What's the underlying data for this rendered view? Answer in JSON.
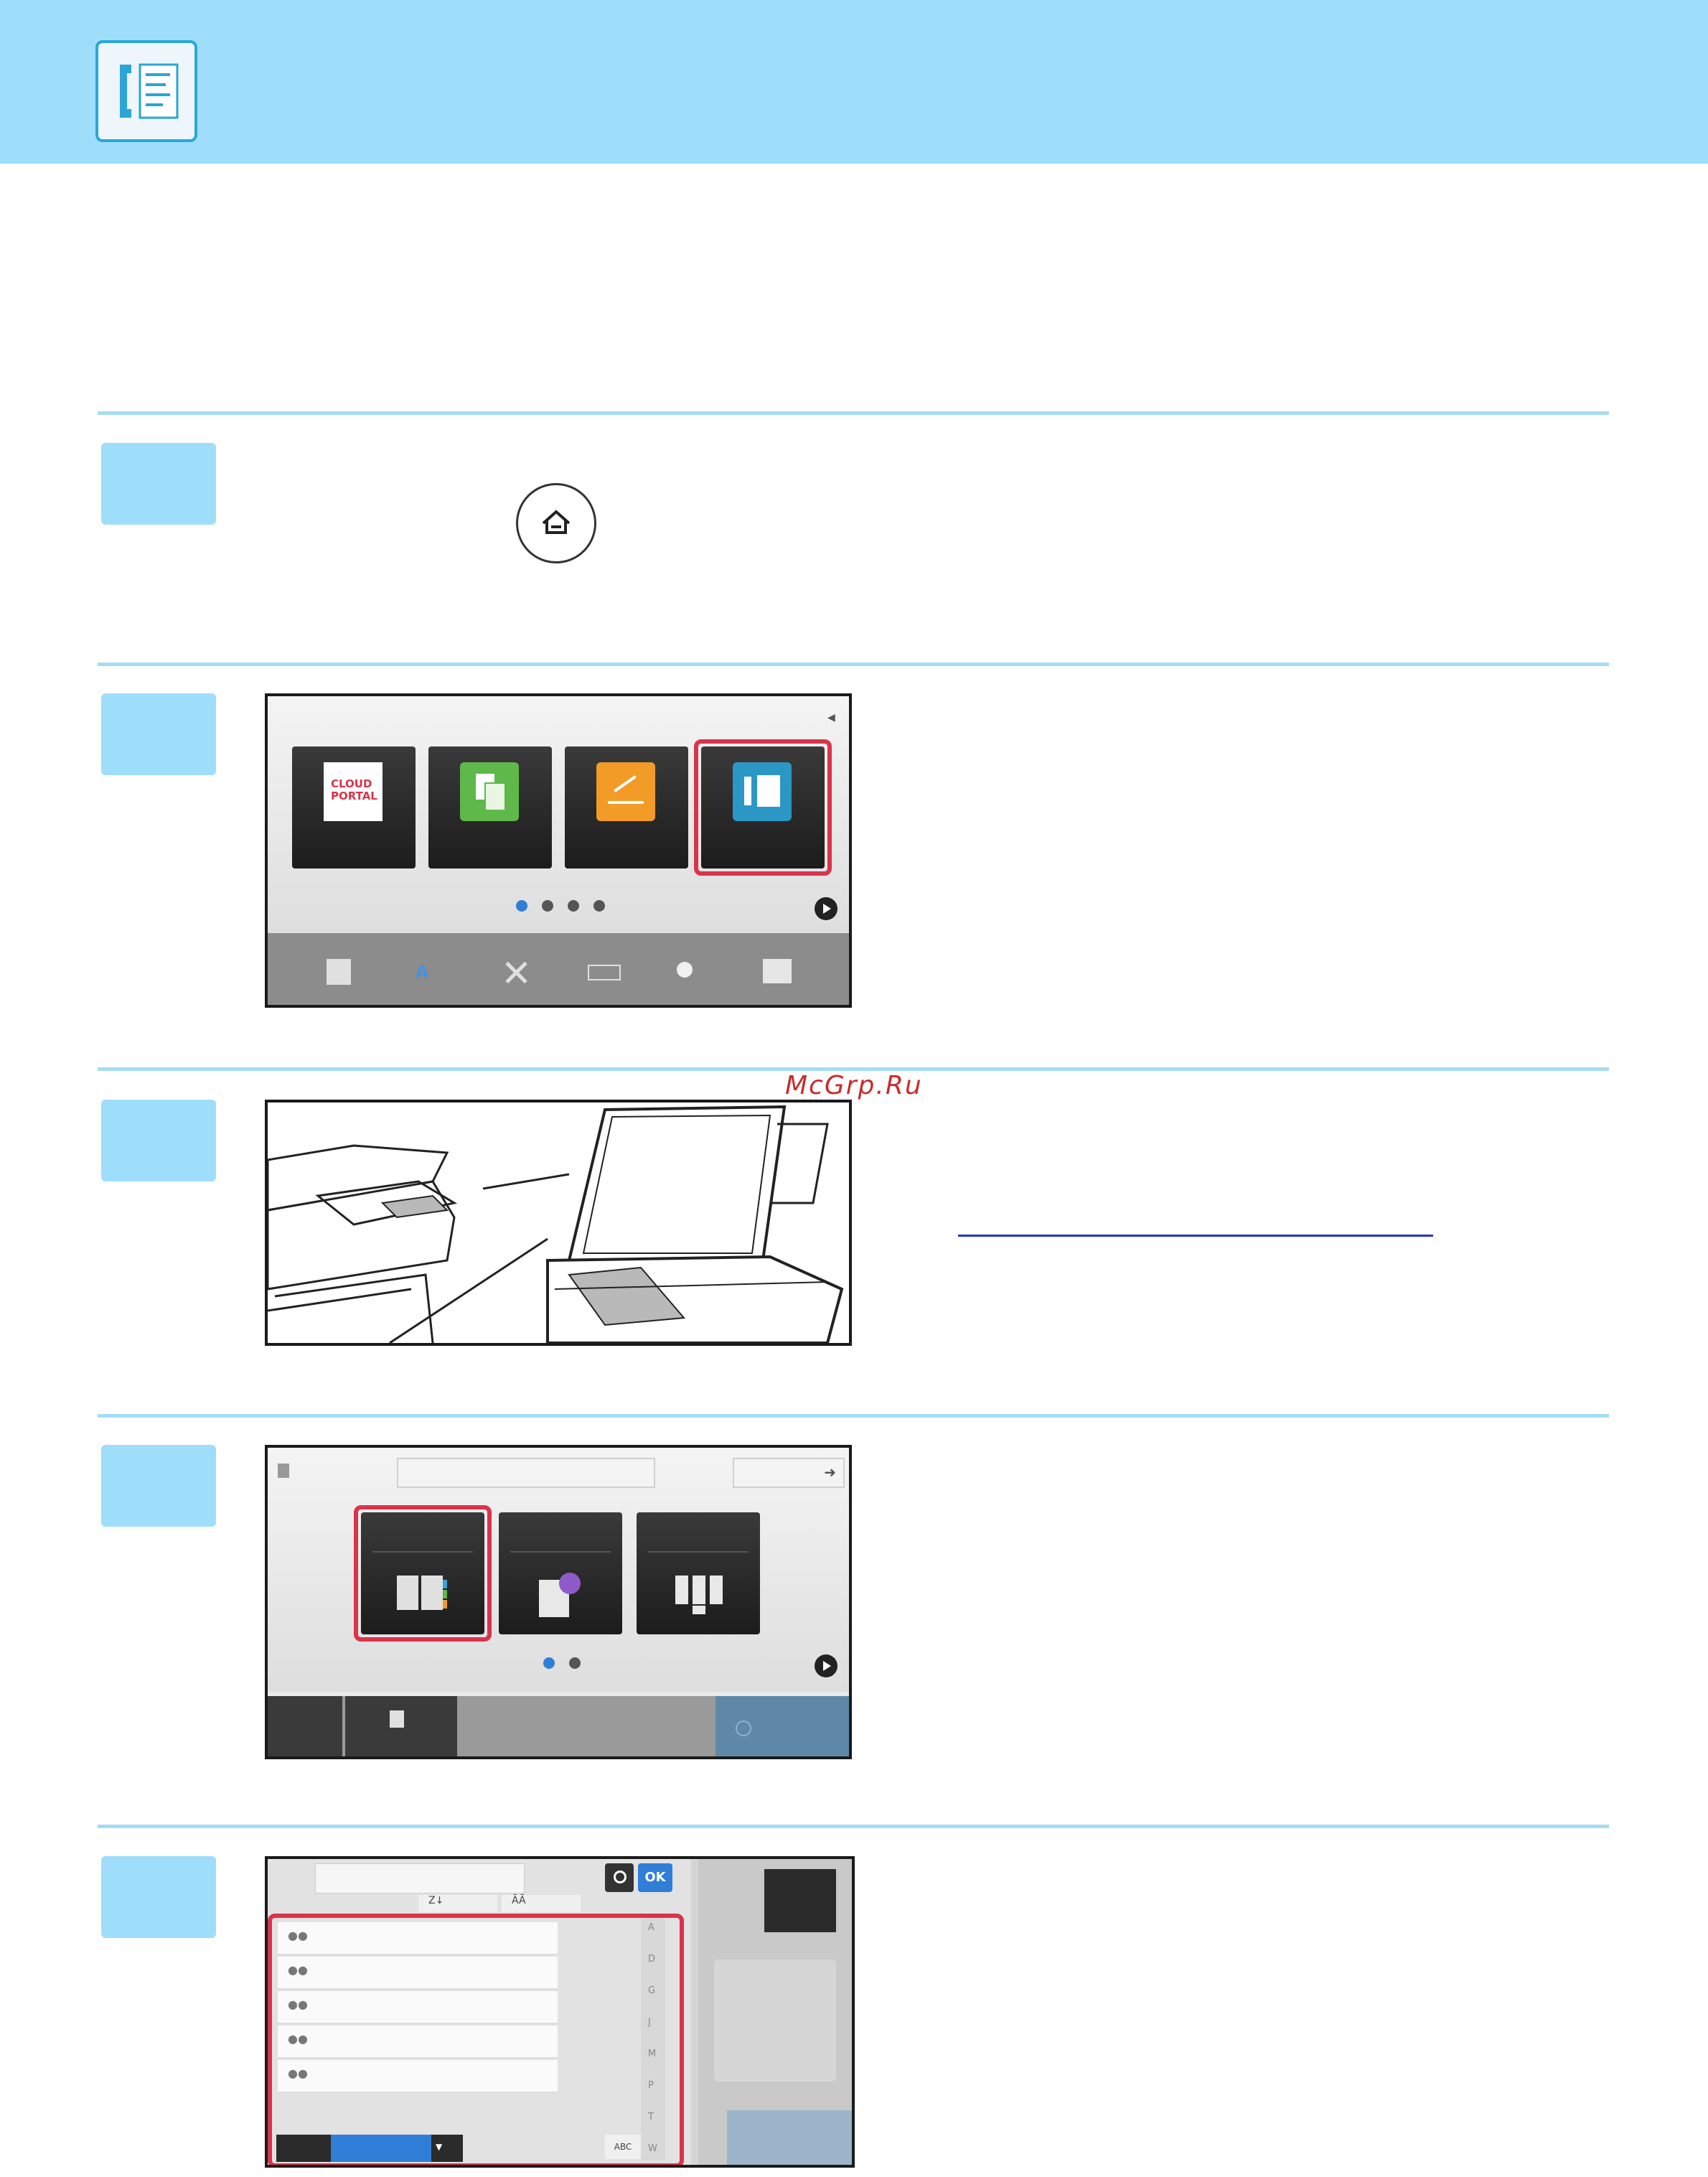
{
  "header": {
    "icon": "fax-icon"
  },
  "step1": {
    "icon": "home-key-icon"
  },
  "step2": {
    "tiles": [
      {
        "icon": "cloud-portal-icon",
        "label": "CLOUD\nPORTAL"
      },
      {
        "icon": "copy-icon"
      },
      {
        "icon": "scan-icon"
      },
      {
        "icon": "fax-icon"
      }
    ],
    "taskbar_icons": [
      "operation-guide-icon",
      "display-pattern-icon",
      "settings-icon",
      "enlarge-display-icon",
      "brightness-icon",
      "job-status-icon"
    ]
  },
  "step3": {
    "image": "document-feeder-and-glass-illustration"
  },
  "step4": {
    "tiles": [
      "address-book-icon",
      "call-history-icon",
      "direct-entry-keypad-icon"
    ]
  },
  "step5": {
    "ok_label": "OK",
    "sort_labels": [
      "Z↓",
      "ĀĀ"
    ],
    "index_letters": [
      "A",
      "D",
      "G",
      "J",
      "M",
      "P",
      "T",
      "W"
    ],
    "keyboard_label": "ABC",
    "row_count": 5
  },
  "watermark": "McGrp.Ru",
  "colors": {
    "header": "#9fdefa",
    "rule": "#a5dcf4",
    "highlight": "#d8344b",
    "accent": "#2f7ed8"
  }
}
